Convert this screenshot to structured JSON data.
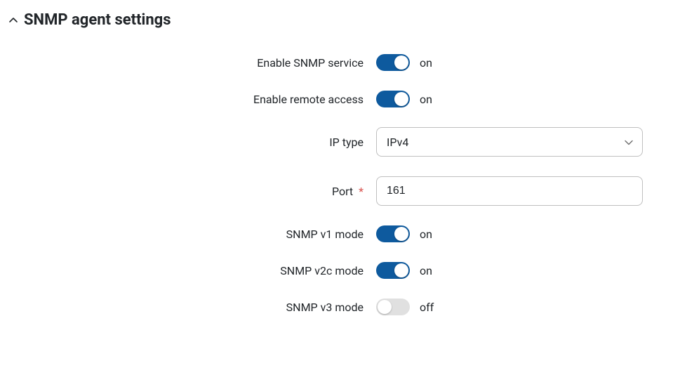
{
  "section": {
    "title": "SNMP agent settings"
  },
  "fields": {
    "enable_service": {
      "label": "Enable SNMP service",
      "state": "on"
    },
    "remote_access": {
      "label": "Enable remote access",
      "state": "on"
    },
    "ip_type": {
      "label": "IP type",
      "value": "IPv4"
    },
    "port": {
      "label": "Port",
      "value": "161",
      "required_mark": "*"
    },
    "v1": {
      "label": "SNMP v1 mode",
      "state": "on"
    },
    "v2c": {
      "label": "SNMP v2c mode",
      "state": "on"
    },
    "v3": {
      "label": "SNMP v3 mode",
      "state": "off"
    }
  }
}
